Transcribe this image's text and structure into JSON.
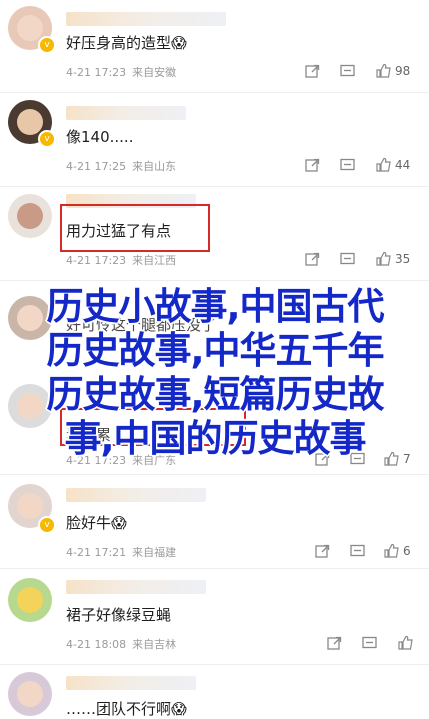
{
  "overlay": {
    "line1": "历史小故事,中国古代",
    "line2": "历史故事,中华五千年",
    "line3": "历史故事,短篇历史故",
    "line4": "事,中国的历史故事"
  },
  "comments": [
    {
      "text": "好压身高的造型",
      "emoji": "😱",
      "time": "4-21 17:23",
      "source": "来自安徽",
      "likes": "98"
    },
    {
      "text": "像140.....",
      "time": "4-21 17:25",
      "source": "来自山东",
      "likes": "44"
    },
    {
      "text": "用力过猛了有点",
      "time": "4-21 17:23",
      "source": "来自江西",
      "likes": "35"
    },
    {
      "text": "好可怜这个腿都压没了",
      "time": "",
      "source": "",
      "likes": ""
    },
    {
      "text": "看着累",
      "time": "4-21 17:23",
      "source": "来自广东",
      "likes": "7"
    },
    {
      "text": "脸好牛",
      "emoji": "😱",
      "time": "4-21 17:21",
      "source": "来自福建",
      "likes": "6"
    },
    {
      "text": "裙子好像绿豆蝇",
      "time": "4-21 18:08",
      "source": "来自吉林",
      "likes": ""
    },
    {
      "text": "……团队不行啊",
      "emoji": "😱",
      "time": "",
      "source": "",
      "likes": ""
    }
  ],
  "icons": {
    "share": "share-icon",
    "reply": "comment-icon",
    "like": "thumbs-up-icon",
    "badge": "verified-badge-icon"
  },
  "colors": {
    "highlight": "#d62a2a",
    "overlay_text": "#1428c8"
  }
}
